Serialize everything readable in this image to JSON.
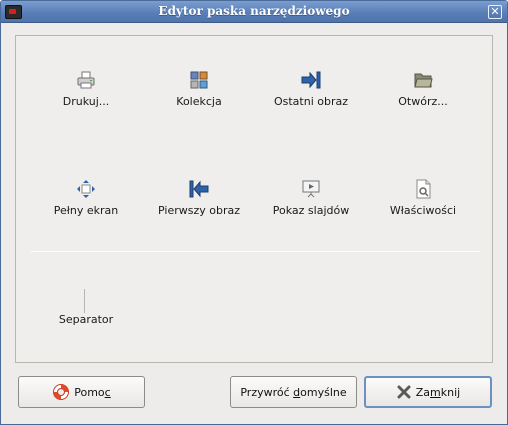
{
  "window": {
    "title": "Edytor paska narzędziowego"
  },
  "tools": [
    {
      "id": "print",
      "label": "Drukuj..."
    },
    {
      "id": "collection",
      "label": "Kolekcja"
    },
    {
      "id": "last-image",
      "label": "Ostatni obraz"
    },
    {
      "id": "open",
      "label": "Otwórz..."
    },
    {
      "id": "fullscreen",
      "label": "Pełny ekran"
    },
    {
      "id": "first-image",
      "label": "Pierwszy obraz"
    },
    {
      "id": "slideshow",
      "label": "Pokaz slajdów"
    },
    {
      "id": "properties",
      "label": "Właściwości"
    }
  ],
  "separator": {
    "label": "Separator"
  },
  "buttons": {
    "help": {
      "prefix": "Pomo",
      "accel": "c",
      "suffix": ""
    },
    "reset": {
      "prefix": "Przywróć ",
      "accel": "d",
      "suffix": "omyślne"
    },
    "close": {
      "prefix": "Za",
      "accel": "m",
      "suffix": "knij"
    }
  },
  "colors": {
    "titlebar": "#5a7fb8",
    "accent_blue": "#2e63a8",
    "default_border": "#6c8fc4"
  }
}
